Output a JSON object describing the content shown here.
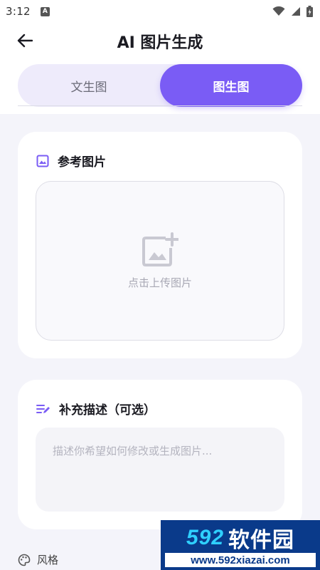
{
  "status_bar": {
    "time": "3:12",
    "notification_badge": "A",
    "icons": [
      "wifi-icon",
      "signal-icon",
      "battery-icon"
    ]
  },
  "header": {
    "title": "AI 图片生成",
    "back_icon": "arrow-left-icon"
  },
  "tabs": [
    {
      "label": "文生图",
      "active": false
    },
    {
      "label": "图生图",
      "active": true
    }
  ],
  "reference_card": {
    "title": "参考图片",
    "icon": "image-icon",
    "upload_label": "点击上传图片",
    "upload_icon": "add-photo-icon"
  },
  "description_card": {
    "title": "补充描述（可选）",
    "icon": "edit-note-icon",
    "placeholder": "描述你希望如何修改或生成图片...",
    "value": ""
  },
  "style_section": {
    "label": "风格",
    "icon": "palette-icon"
  },
  "watermark": {
    "brand_number": "592",
    "brand_name": "软件园",
    "url": "www.592xiazai.com"
  },
  "colors": {
    "accent": "#7a5cf5",
    "tab_track": "#eeebfb",
    "background": "#f4f4fa"
  }
}
